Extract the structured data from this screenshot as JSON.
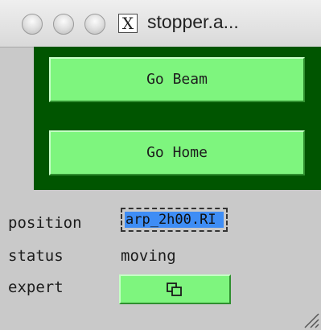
{
  "window": {
    "title": "stopper.a..."
  },
  "buttons": {
    "go_beam": "Go Beam",
    "go_home": "Go Home"
  },
  "fields": {
    "position_label": "position",
    "position_value": "arp_2h00.RI",
    "status_label": "status",
    "status_value": "moving",
    "expert_label": "expert"
  },
  "icons": {
    "window_controls": [
      "close-icon",
      "minimize-icon",
      "zoom-icon"
    ],
    "app": "x11-icon",
    "expert_button": "related-display-icon",
    "resize": "resize-grip-icon"
  },
  "colors": {
    "panel": "#005500",
    "button": "#7ef57e",
    "selection": "#3e8df5",
    "background": "#c9c9c9"
  }
}
